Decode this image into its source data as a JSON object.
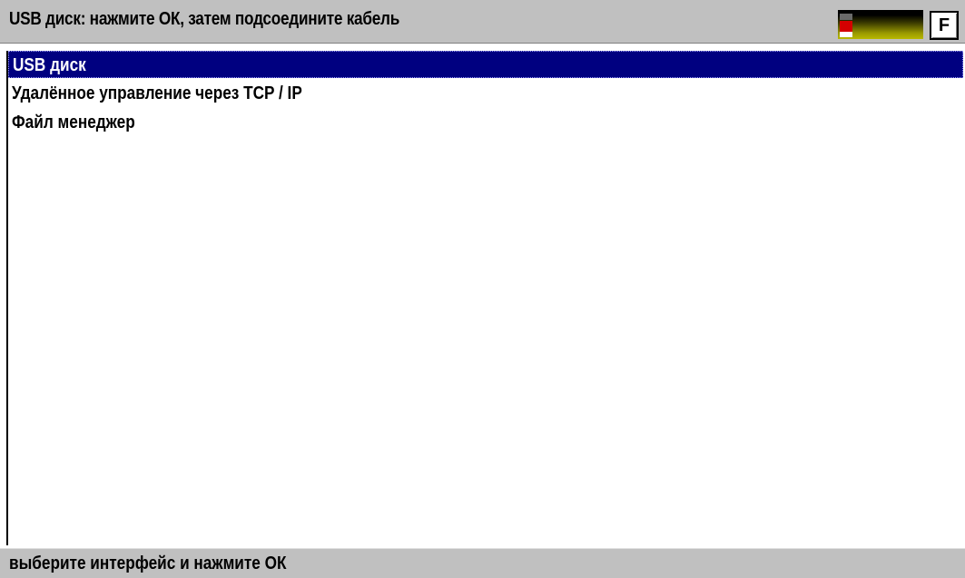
{
  "header": {
    "title": "USB диск: нажмите ОК, затем подсоедините кабель",
    "f_button_label": "F",
    "level_indicator_icon": "battery-level-icon",
    "colors": {
      "header_bg": "#c0c0c0",
      "indicator_marker": "#d40000",
      "indicator_fill": "#b8b800"
    }
  },
  "menu": {
    "items": [
      {
        "label": "USB диск",
        "selected": true
      },
      {
        "label": "Удалённое управление через TCP / IP",
        "selected": false
      },
      {
        "label": "Файл менеджер",
        "selected": false
      }
    ],
    "colors": {
      "selected_bg": "#000080",
      "selected_fg": "#ffffff"
    }
  },
  "footer": {
    "hint": "выберите интерфейс и нажмите ОК"
  }
}
